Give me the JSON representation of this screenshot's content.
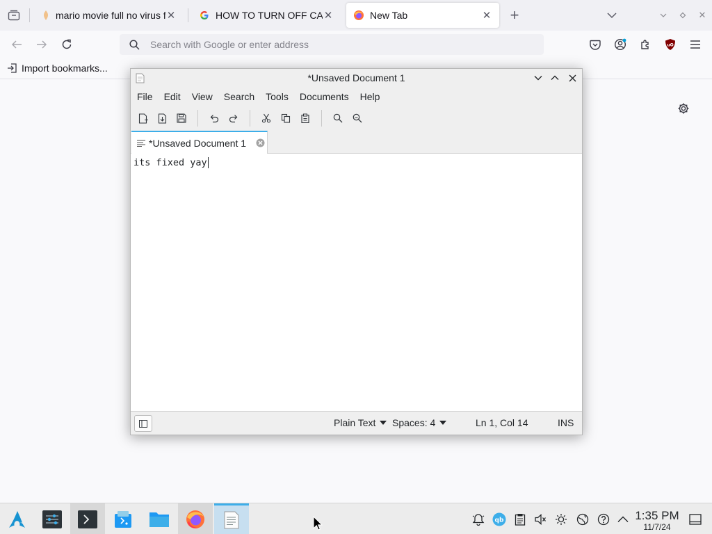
{
  "browser": {
    "tabs": [
      {
        "title": "mario movie full no virus f",
        "active": false
      },
      {
        "title": "HOW TO TURN OFF CAPS (",
        "active": false
      },
      {
        "title": "New Tab",
        "active": true
      }
    ],
    "urlbar_placeholder": "Search with Google or enter address",
    "bookmarks_import_label": "Import bookmarks..."
  },
  "editor": {
    "window_title": "*Unsaved Document 1",
    "menu": [
      "File",
      "Edit",
      "View",
      "Search",
      "Tools",
      "Documents",
      "Help"
    ],
    "tab_title": "*Unsaved Document 1",
    "text": "its fixed yay",
    "status": {
      "syntax": "Plain Text",
      "indent": "Spaces: 4",
      "position": "Ln 1, Col 14",
      "mode": "INS"
    }
  },
  "taskbar": {
    "apps": [
      "arch-launcher",
      "settings",
      "terminal",
      "software-center",
      "file-manager",
      "firefox",
      "text-editor"
    ],
    "tray": [
      "notifications-icon",
      "qbittorrent-icon",
      "clipboard-icon",
      "volume-muted-icon",
      "brightness-icon",
      "network-icon",
      "help-icon",
      "tray-expand-icon"
    ],
    "time": "1:35 PM",
    "date": "11/7/24"
  },
  "colors": {
    "accent": "#3daee9",
    "ublock": "#800000",
    "firefox_orange": "#ff7139"
  }
}
